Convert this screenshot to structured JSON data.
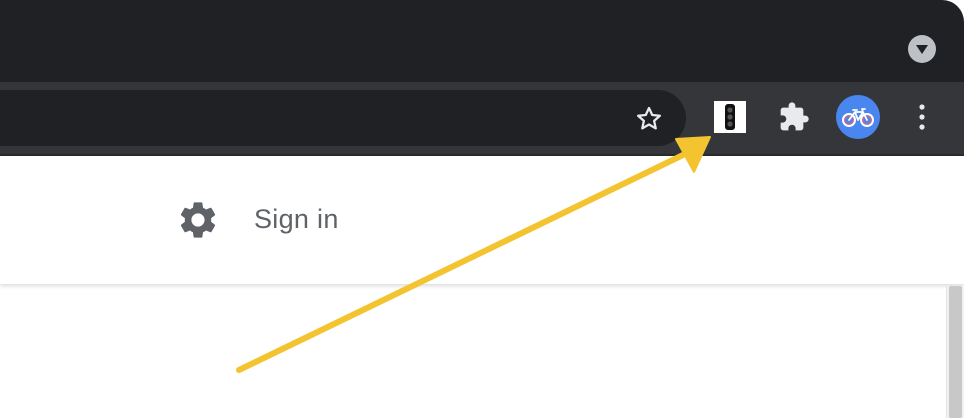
{
  "browser": {
    "tab_search_icon": "chevron-down-icon",
    "bookmark_icon": "star-outline-icon",
    "extensions": [
      {
        "name": "traffic-light-extension",
        "icon": "traffic-light-icon"
      },
      {
        "name": "extensions-menu",
        "icon": "puzzle-piece-icon"
      }
    ],
    "profile_icon": "bicycle-icon",
    "menu_icon": "kebab-menu-icon"
  },
  "ntp": {
    "settings_icon": "gear-icon",
    "signin_label": "Sign in"
  },
  "annotation": {
    "type": "arrow",
    "color": "#f4c430",
    "points_to": "traffic-light-extension"
  },
  "colors": {
    "tabstrip_bg": "#202124",
    "toolbar_bg": "#35363a",
    "omnibox_bg": "#202124",
    "icon_light": "#e8eaed",
    "avatar_bg": "#4a86f0",
    "text_gray": "#5f6368"
  }
}
